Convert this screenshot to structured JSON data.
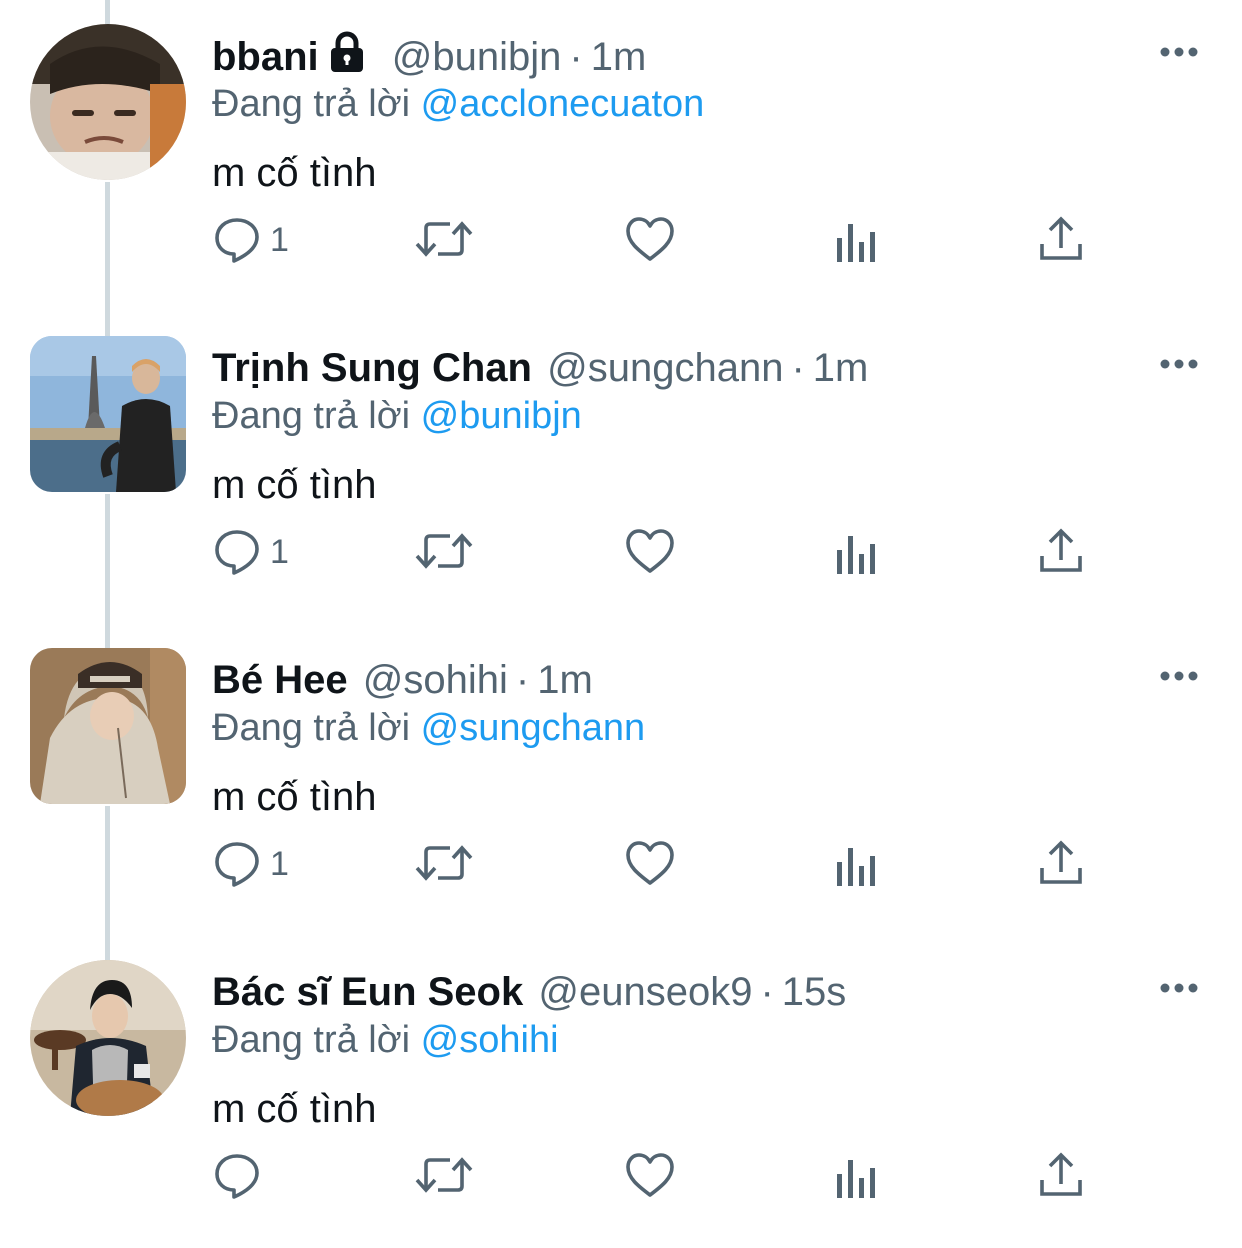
{
  "tweets": [
    {
      "name": "bbani",
      "protected": true,
      "handle": "@bunibjn",
      "sep": "·",
      "time": "1m",
      "replying_label": "Đang trả lời",
      "replying_to": "@acclonecuaton",
      "text": "m cố tình",
      "reply_count": "1"
    },
    {
      "name": "Trịnh Sung Chan",
      "protected": false,
      "handle": "@sungchann",
      "sep": "·",
      "time": "1m",
      "replying_label": "Đang trả lời",
      "replying_to": "@bunibjn",
      "text": "m cố tình",
      "reply_count": "1"
    },
    {
      "name": "Bé Hee",
      "protected": false,
      "handle": "@sohihi",
      "sep": "·",
      "time": "1m",
      "replying_label": "Đang trả lời",
      "replying_to": "@sungchann",
      "text": "m cố tình",
      "reply_count": "1"
    },
    {
      "name": "Bác sĩ Eun Seok",
      "protected": false,
      "handle": "@eunseok9",
      "sep": "·",
      "time": "15s",
      "replying_label": "Đang trả lời",
      "replying_to": "@sohihi",
      "text": "m cố tình",
      "reply_count": ""
    }
  ],
  "colors": {
    "text": "#0f1419",
    "secondary": "#536471",
    "link": "#1d9bf0",
    "thread_line": "#cfd9de"
  },
  "icons": [
    "lock-icon",
    "more-icon",
    "reply-icon",
    "retweet-icon",
    "like-icon",
    "analytics-icon",
    "share-icon"
  ]
}
